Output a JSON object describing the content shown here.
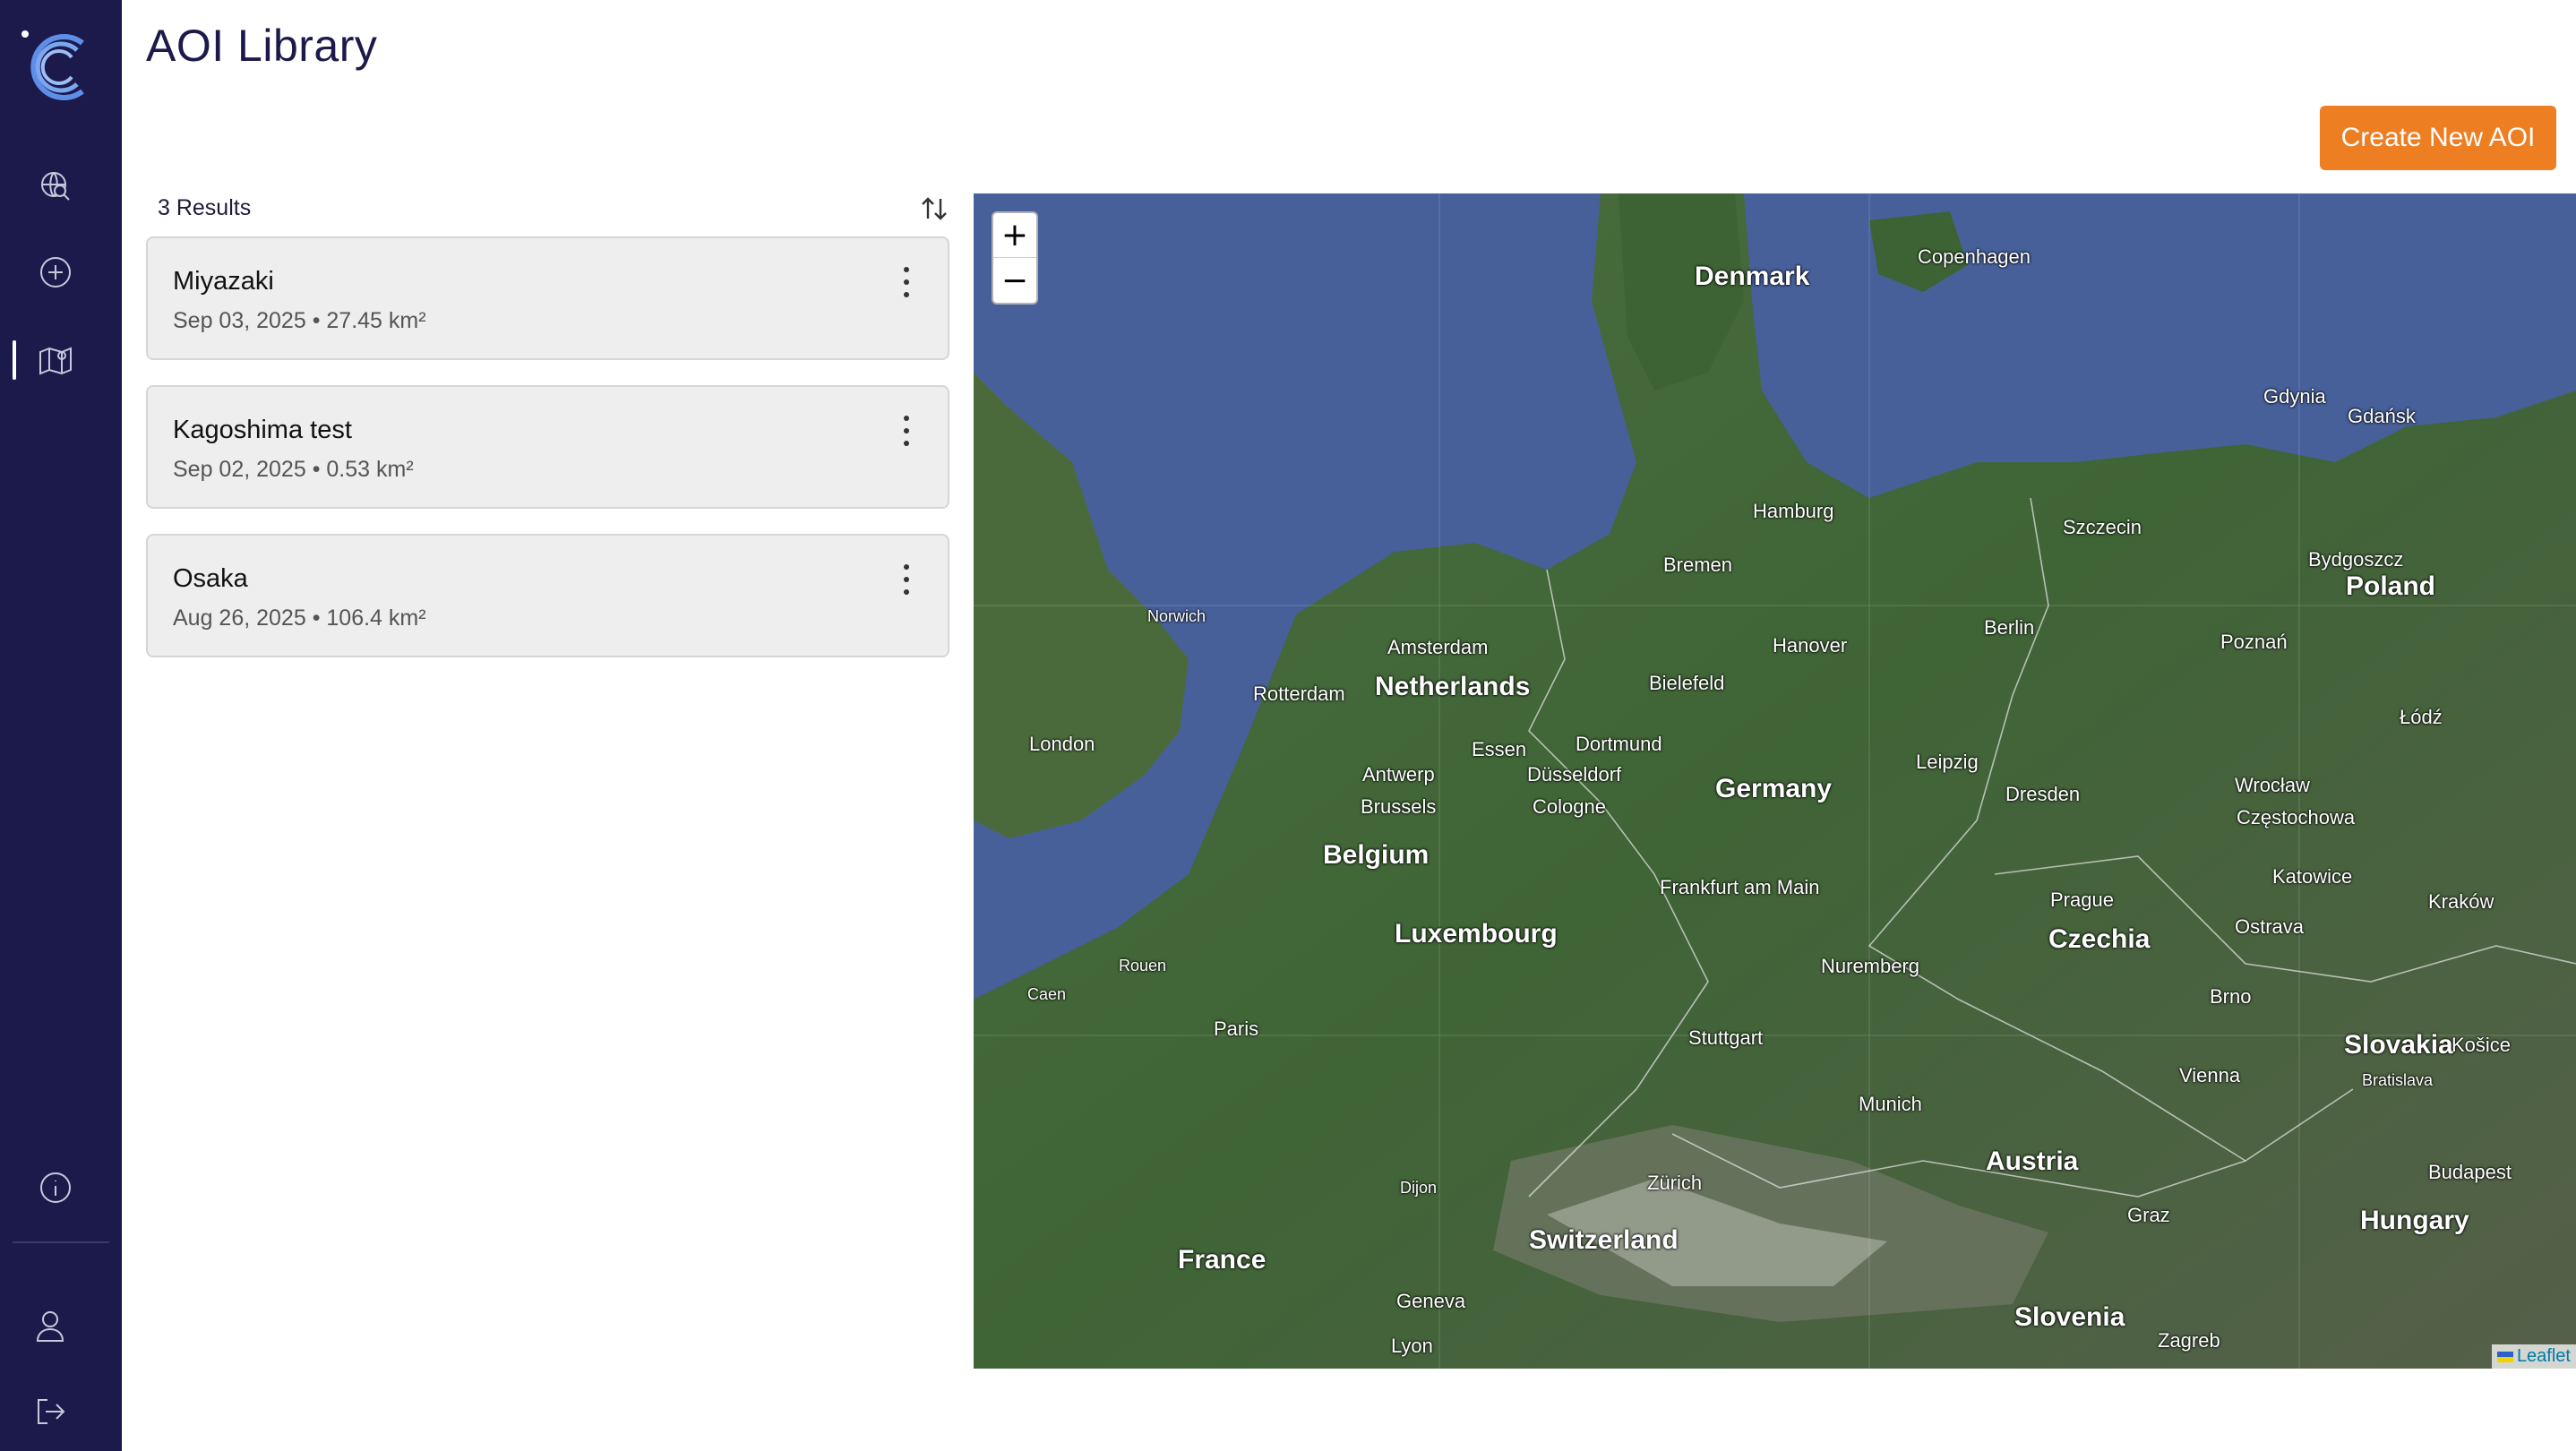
{
  "page": {
    "title": "AOI Library",
    "create_button": "Create New AOI"
  },
  "results": {
    "count_label": "3 Results"
  },
  "aois": [
    {
      "name": "Miyazaki",
      "meta": "Sep 03, 2025 • 27.45 km²"
    },
    {
      "name": "Kagoshima test",
      "meta": "Sep 02, 2025 • 0.53 km²"
    },
    {
      "name": "Osaka",
      "meta": "Aug 26, 2025 • 106.4 km²"
    }
  ],
  "map": {
    "zoom_in": "+",
    "zoom_out": "−",
    "attribution": "Leaflet",
    "countries": [
      "Denmark",
      "Netherlands",
      "Belgium",
      "Luxembourg",
      "Germany",
      "Poland",
      "Czechia",
      "Slovakia",
      "Austria",
      "Switzerland",
      "France",
      "Hungary",
      "Slovenia"
    ],
    "cities": [
      "Copenhagen",
      "Hamburg",
      "Bremen",
      "Amsterdam",
      "Rotterdam",
      "Hanover",
      "Berlin",
      "Szczecin",
      "Gdańsk",
      "Gdynia",
      "Bydgoszcz",
      "Poznań",
      "Bielefeld",
      "Dortmund",
      "Essen",
      "Düsseldorf",
      "Cologne",
      "Antwerp",
      "Brussels",
      "London",
      "Norwich",
      "Leipzig",
      "Dresden",
      "Wrocław",
      "Łódź",
      "Frankfurt am Main",
      "Prague",
      "Częstochowa",
      "Katowice",
      "Kraków",
      "Ostrava",
      "Brno",
      "Nuremberg",
      "Stuttgart",
      "Paris",
      "Munich",
      "Vienna",
      "Bratislava",
      "Zürich",
      "Geneva",
      "Lyon",
      "Graz",
      "Budapest",
      "Zagreb",
      "Košice",
      "Dijon",
      "Rouen",
      "Caen"
    ]
  },
  "colors": {
    "sidebar": "#1b1a4b",
    "accent": "#ee7e22"
  }
}
